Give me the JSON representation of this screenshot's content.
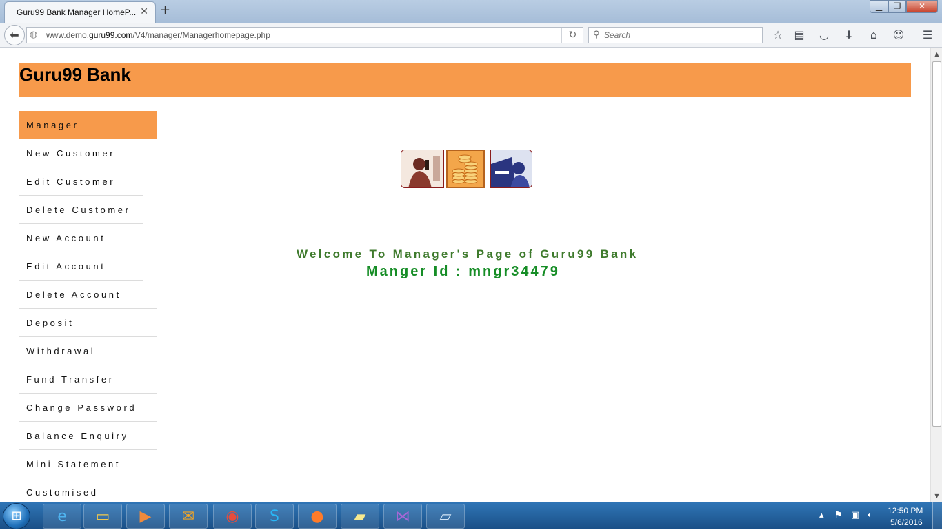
{
  "browser": {
    "tab_title": "Guru99 Bank Manager HomeP...",
    "url_prefix": "www.demo.",
    "url_domain": "guru99.com",
    "url_path": "/V4/manager/Managerhomepage.php",
    "search_placeholder": "Search"
  },
  "page": {
    "bank_title": "Guru99 Bank",
    "welcome_text": "Welcome To Manager's Page of Guru99 Bank",
    "manager_id_text": "Manger Id : mngr34479"
  },
  "menu": {
    "items": [
      {
        "label": "Manager"
      },
      {
        "label": "New Customer"
      },
      {
        "label": "Edit Customer"
      },
      {
        "label": "Delete Customer"
      },
      {
        "label": "New Account"
      },
      {
        "label": "Edit Account"
      },
      {
        "label": "Delete Account"
      },
      {
        "label": "Deposit"
      },
      {
        "label": "Withdrawal"
      },
      {
        "label": "Fund Transfer"
      },
      {
        "label": "Change Password"
      },
      {
        "label": "Balance Enquiry"
      },
      {
        "label": "Mini Statement"
      },
      {
        "label": "Customised"
      }
    ]
  },
  "taskbar": {
    "time": "12:50 PM",
    "date": "5/6/2016"
  },
  "colors": {
    "banner": "#f79a4b",
    "welcome": "#3e7a2c",
    "manager_id": "#168d26"
  }
}
